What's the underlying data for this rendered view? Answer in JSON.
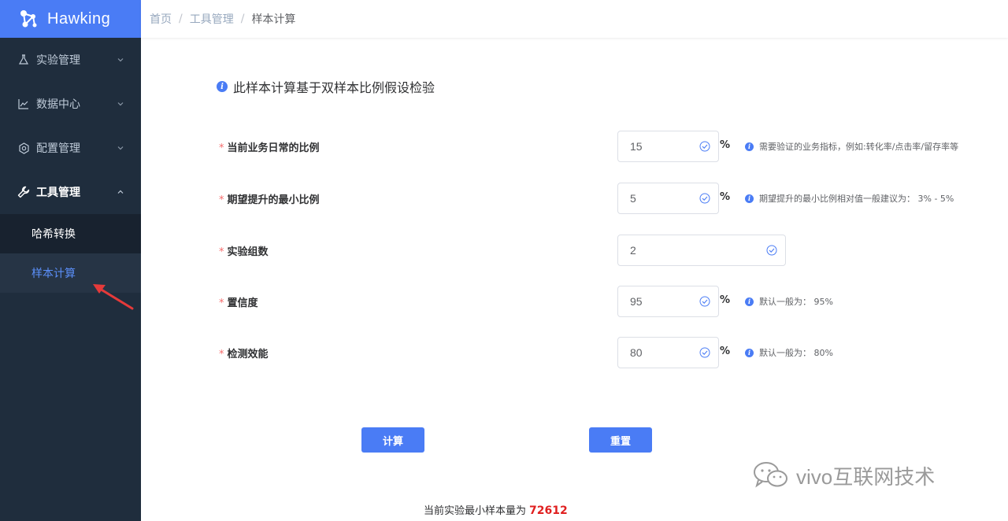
{
  "brand": {
    "name": "Hawking"
  },
  "sidebar": {
    "items": [
      {
        "label": "实验管理",
        "icon": "flask-icon"
      },
      {
        "label": "数据中心",
        "icon": "line-chart-icon"
      },
      {
        "label": "配置管理",
        "icon": "settings-icon"
      },
      {
        "label": "工具管理",
        "icon": "wrench-icon"
      }
    ],
    "subitems": [
      {
        "label": "哈希转换"
      },
      {
        "label": "样本计算"
      }
    ]
  },
  "breadcrumb": {
    "home": "首页",
    "section": "工具管理",
    "current": "样本计算",
    "sep": "/"
  },
  "intro": {
    "text": "此样本计算基于双样本比例假设检验"
  },
  "form": {
    "required_mark": "*",
    "fields": [
      {
        "label": "当前业务日常的比例",
        "value": "15",
        "unit": "%",
        "hint": "需要验证的业务指标，例如:转化率/点击率/留存率等"
      },
      {
        "label": "期望提升的最小比例",
        "value": "5",
        "unit": "%",
        "hint": "期望提升的最小比例相对值一般建议为： 3% - 5%"
      },
      {
        "label": "实验组数",
        "value": "2"
      },
      {
        "label": "置信度",
        "value": "95",
        "unit": "%",
        "hint": "默认一般为： 95%"
      },
      {
        "label": "检测效能",
        "value": "80",
        "unit": "%",
        "hint": "默认一般为： 80%"
      }
    ]
  },
  "buttons": {
    "calculate": "计算",
    "reset": "重置"
  },
  "result": {
    "label": "当前实验最小样本量为",
    "value": "72612"
  },
  "watermark": {
    "text": "vivo互联网技术"
  },
  "colors": {
    "primary": "#4a7cf5",
    "sidebar_bg": "#1f2d3d",
    "required": "#f56c6c",
    "result_number": "#e02020"
  }
}
